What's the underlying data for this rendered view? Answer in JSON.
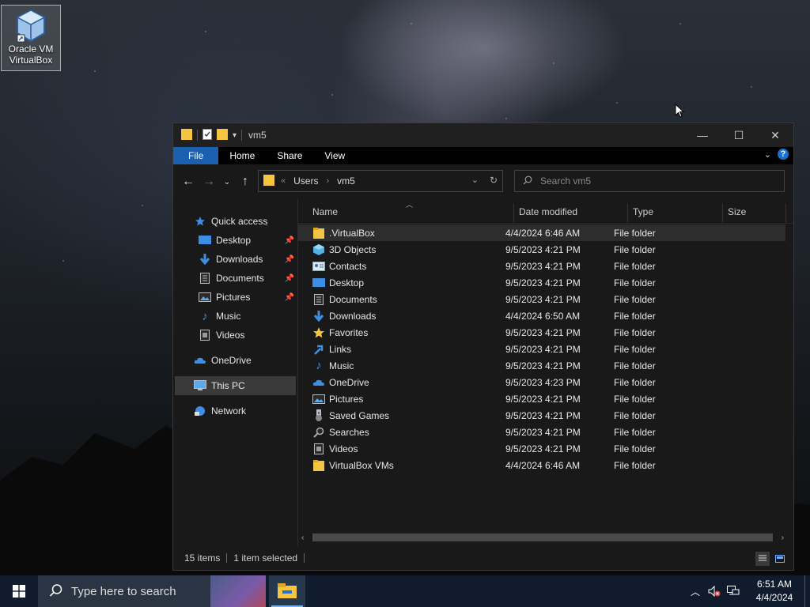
{
  "desktop": {
    "icon_label_line1": "Oracle VM",
    "icon_label_line2": "VirtualBox"
  },
  "window": {
    "title": "vm5",
    "controls": {
      "minimize": "—",
      "maximize": "☐",
      "close": "✕"
    },
    "ribbon_tabs": [
      {
        "label": "File"
      },
      {
        "label": "Home"
      },
      {
        "label": "Share"
      },
      {
        "label": "View"
      }
    ],
    "help_label": "?",
    "address": {
      "prefix": "«",
      "crumbs": [
        "Users",
        "vm5"
      ],
      "separator": "›"
    },
    "search": {
      "placeholder": "Search vm5"
    },
    "nav_pane": {
      "quick_access": "Quick access",
      "items": [
        {
          "label": "Desktop",
          "icon": "desktop-icon",
          "pinned": true
        },
        {
          "label": "Downloads",
          "icon": "downloads-icon",
          "pinned": true
        },
        {
          "label": "Documents",
          "icon": "documents-icon",
          "pinned": true
        },
        {
          "label": "Pictures",
          "icon": "pictures-icon",
          "pinned": true
        },
        {
          "label": "Music",
          "icon": "music-icon",
          "pinned": false
        },
        {
          "label": "Videos",
          "icon": "videos-icon",
          "pinned": false
        }
      ],
      "onedrive": "OneDrive",
      "this_pc": "This PC",
      "network": "Network"
    },
    "columns": {
      "name": "Name",
      "date": "Date modified",
      "type": "Type",
      "size": "Size"
    },
    "files": [
      {
        "name": ".VirtualBox",
        "date": "4/4/2024 6:46 AM",
        "type": "File folder",
        "icon": "folder-icon"
      },
      {
        "name": "3D Objects",
        "date": "9/5/2023 4:21 PM",
        "type": "File folder",
        "icon": "3d-objects-icon"
      },
      {
        "name": "Contacts",
        "date": "9/5/2023 4:21 PM",
        "type": "File folder",
        "icon": "contacts-icon"
      },
      {
        "name": "Desktop",
        "date": "9/5/2023 4:21 PM",
        "type": "File folder",
        "icon": "desktop-icon"
      },
      {
        "name": "Documents",
        "date": "9/5/2023 4:21 PM",
        "type": "File folder",
        "icon": "documents-icon"
      },
      {
        "name": "Downloads",
        "date": "4/4/2024 6:50 AM",
        "type": "File folder",
        "icon": "downloads-icon"
      },
      {
        "name": "Favorites",
        "date": "9/5/2023 4:21 PM",
        "type": "File folder",
        "icon": "favorites-icon"
      },
      {
        "name": "Links",
        "date": "9/5/2023 4:21 PM",
        "type": "File folder",
        "icon": "links-icon"
      },
      {
        "name": "Music",
        "date": "9/5/2023 4:21 PM",
        "type": "File folder",
        "icon": "music-icon"
      },
      {
        "name": "OneDrive",
        "date": "9/5/2023 4:23 PM",
        "type": "File folder",
        "icon": "onedrive-icon"
      },
      {
        "name": "Pictures",
        "date": "9/5/2023 4:21 PM",
        "type": "File folder",
        "icon": "pictures-icon"
      },
      {
        "name": "Saved Games",
        "date": "9/5/2023 4:21 PM",
        "type": "File folder",
        "icon": "saved-games-icon"
      },
      {
        "name": "Searches",
        "date": "9/5/2023 4:21 PM",
        "type": "File folder",
        "icon": "searches-icon"
      },
      {
        "name": "Videos",
        "date": "9/5/2023 4:21 PM",
        "type": "File folder",
        "icon": "videos-icon"
      },
      {
        "name": "VirtualBox VMs",
        "date": "4/4/2024 6:46 AM",
        "type": "File folder",
        "icon": "folder-icon"
      }
    ],
    "status": {
      "items_count": "15 items",
      "selection": "1 item selected"
    }
  },
  "taskbar": {
    "search_placeholder": "Type here to search",
    "clock_time": "6:51 AM",
    "clock_date": "4/4/2024"
  },
  "colors": {
    "accent": "#1a5fb0",
    "folder": "#f4c542",
    "taskbar": "#101c2e"
  }
}
